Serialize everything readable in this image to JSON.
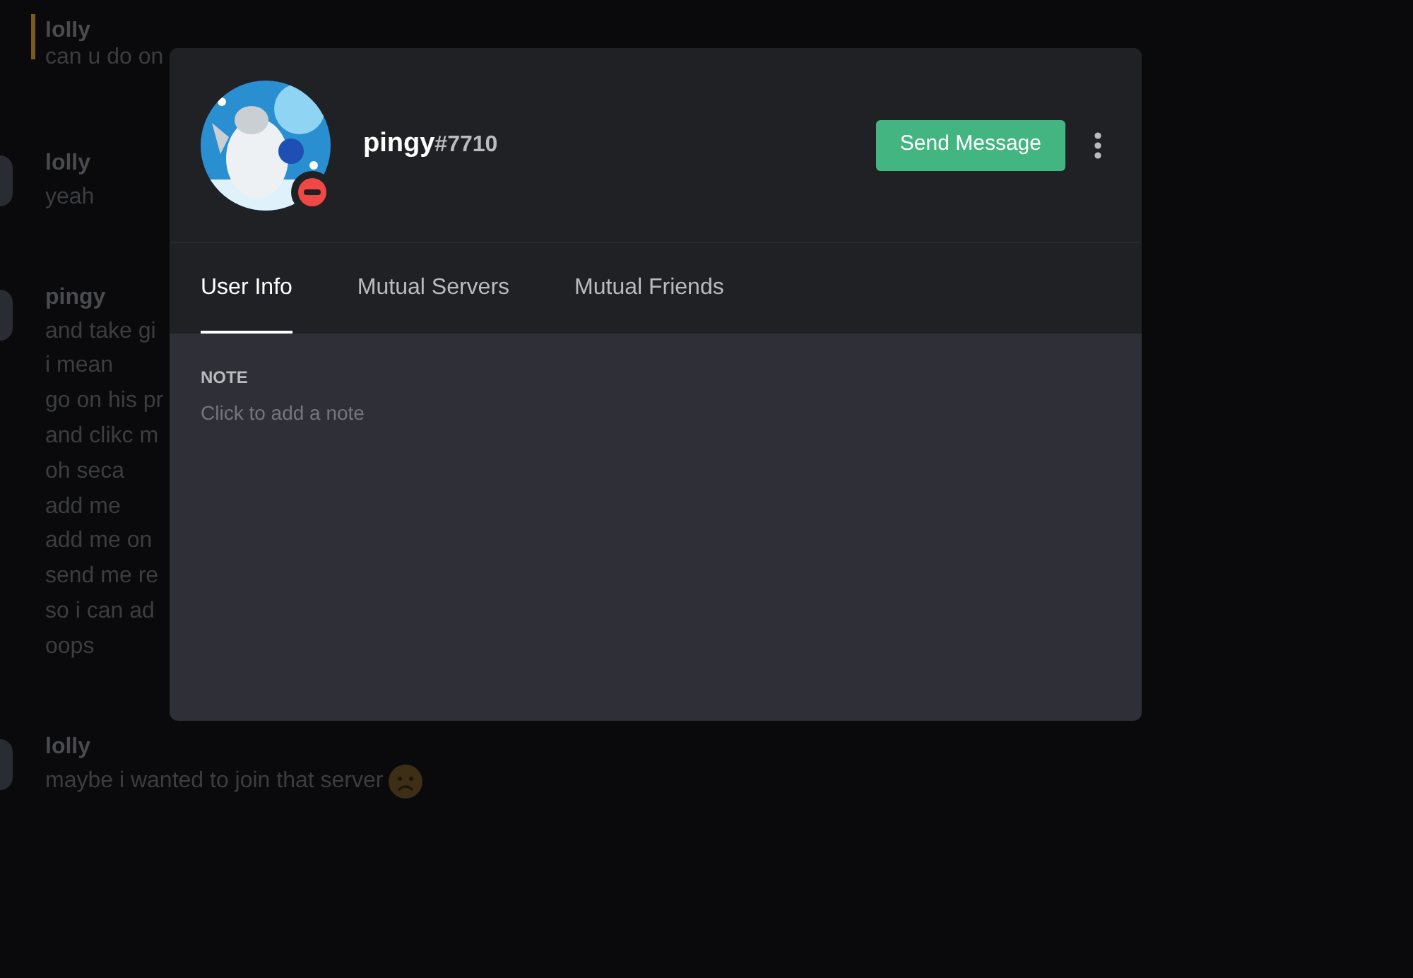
{
  "chat": {
    "messages": [
      {
        "author": "lolly",
        "highlighted": true,
        "author_cut": true,
        "lines": [
          "can u do on"
        ]
      },
      {
        "author": "lolly",
        "highlighted": false,
        "author_cut": false,
        "lines": [
          "yeah"
        ]
      },
      {
        "author": "pingy",
        "highlighted": false,
        "author_cut": false,
        "lines": [
          "and take gi",
          "i mean",
          "go on his pr",
          "and clikc m",
          "oh seca",
          "add me",
          "add me on",
          "send me re",
          "so i can ad",
          "oops"
        ]
      },
      {
        "author": "lolly",
        "highlighted": false,
        "author_cut": false,
        "lines": [
          "maybe i wanted to join that server"
        ],
        "sad_emoji": true
      }
    ]
  },
  "profile": {
    "username": "pingy",
    "discriminator": "#7710",
    "do_not_disturb": true,
    "send_button": "Send Message",
    "tabs": [
      {
        "label": "User Info",
        "selected": true
      },
      {
        "label": "Mutual Servers",
        "selected": false
      },
      {
        "label": "Mutual Friends",
        "selected": false
      }
    ],
    "note": {
      "label": "NOTE",
      "placeholder": "Click to add a note"
    }
  }
}
